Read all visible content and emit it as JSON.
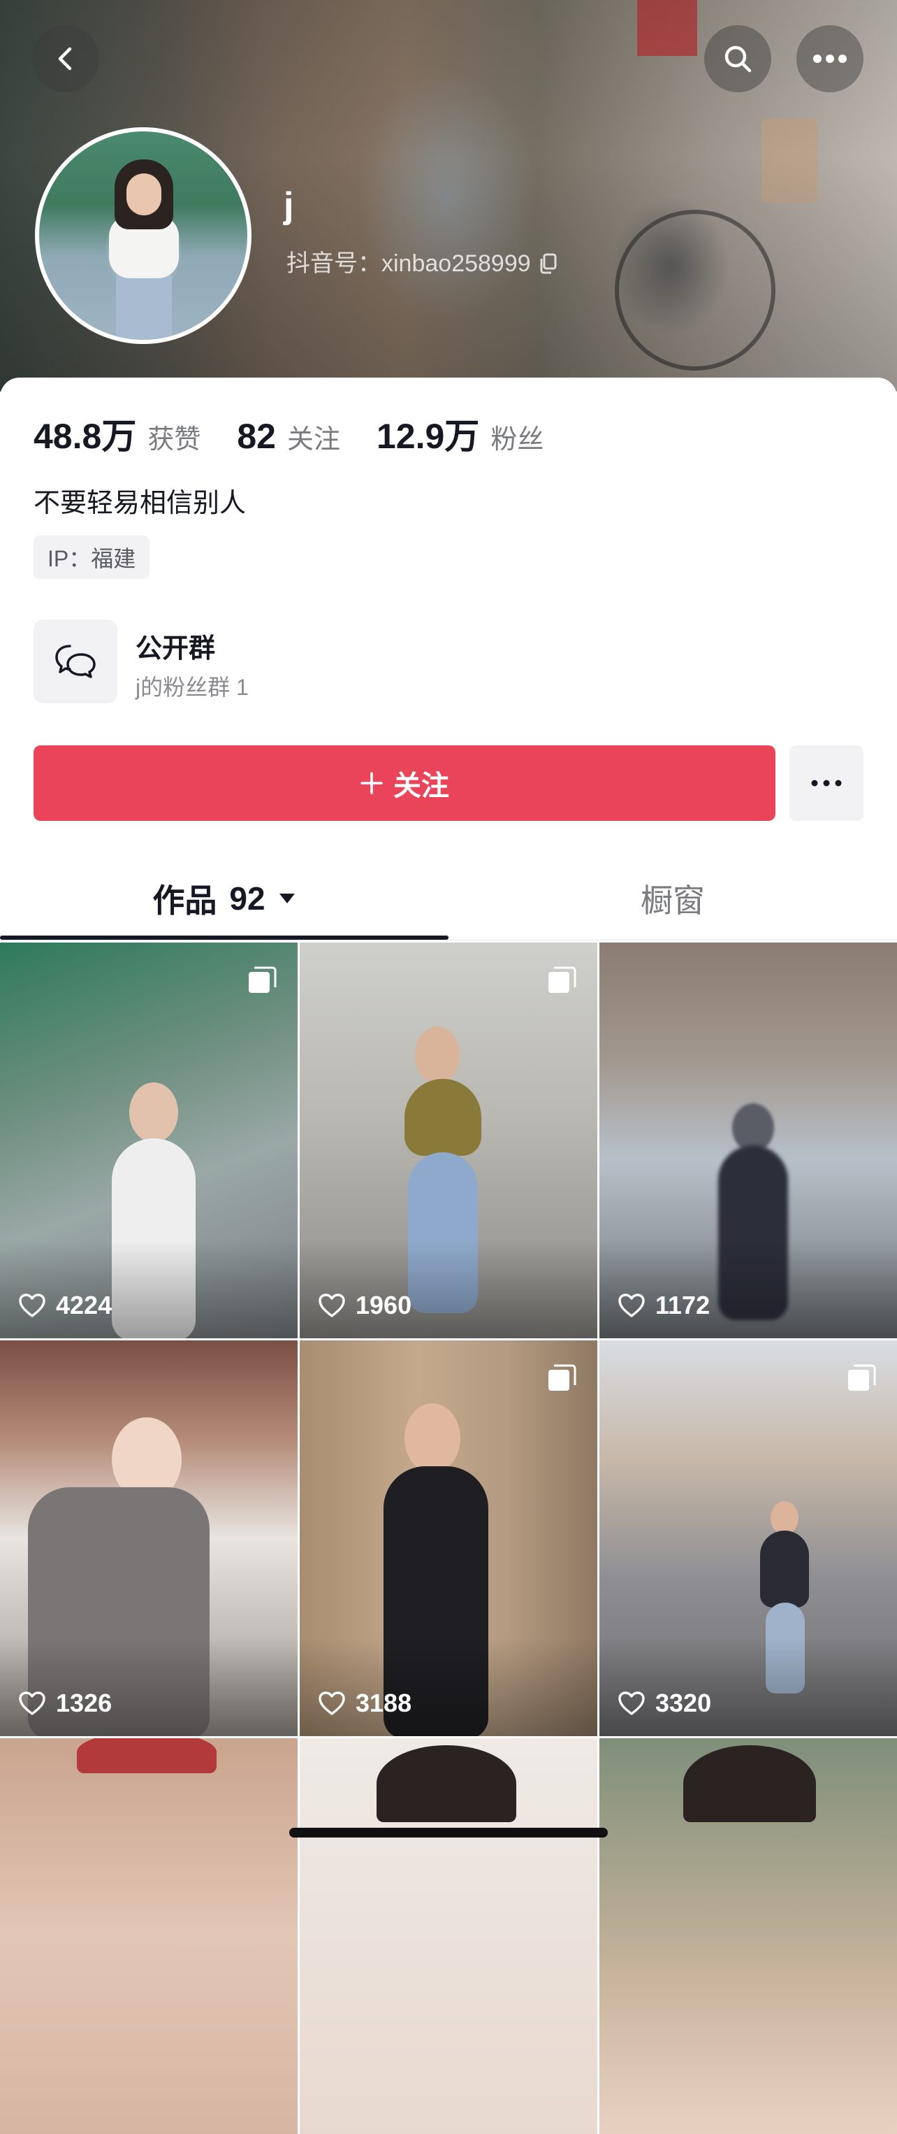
{
  "profile": {
    "nickname": "j",
    "douyin_id": "抖音号：xinbao258999",
    "stats": [
      {
        "num": "48.8万",
        "label": "获赞"
      },
      {
        "num": "82",
        "label": "关注"
      },
      {
        "num": "12.9万",
        "label": "粉丝"
      }
    ],
    "bio": "不要轻易相信别人",
    "ip": "IP：福建"
  },
  "group": {
    "title": "公开群",
    "subtitle": "j的粉丝群 1"
  },
  "actions": {
    "follow_label": "关注",
    "follow_icon": "+"
  },
  "tabs": {
    "works_label": "作品",
    "works_count": "92",
    "window_label": "橱窗"
  },
  "videos": [
    {
      "likes": "4224",
      "multi": true
    },
    {
      "likes": "1960",
      "multi": true
    },
    {
      "likes": "1172",
      "multi": false
    },
    {
      "likes": "1326",
      "multi": false
    },
    {
      "likes": "3188",
      "multi": true
    },
    {
      "likes": "3320",
      "multi": true
    },
    {
      "likes": "",
      "multi": false
    },
    {
      "likes": "",
      "multi": false
    },
    {
      "likes": "",
      "multi": false
    }
  ],
  "icons": {
    "back": "back-arrow-icon",
    "search": "search-icon",
    "more": "more-dots-icon",
    "copy": "copy-icon",
    "chat": "chat-bubbles-icon",
    "like": "heart-icon",
    "multi": "multi-image-icon",
    "caret": "caret-down-icon"
  },
  "colors": {
    "accent": "#ea445a",
    "text_primary": "#161823",
    "text_secondary": "#7a7b80"
  }
}
